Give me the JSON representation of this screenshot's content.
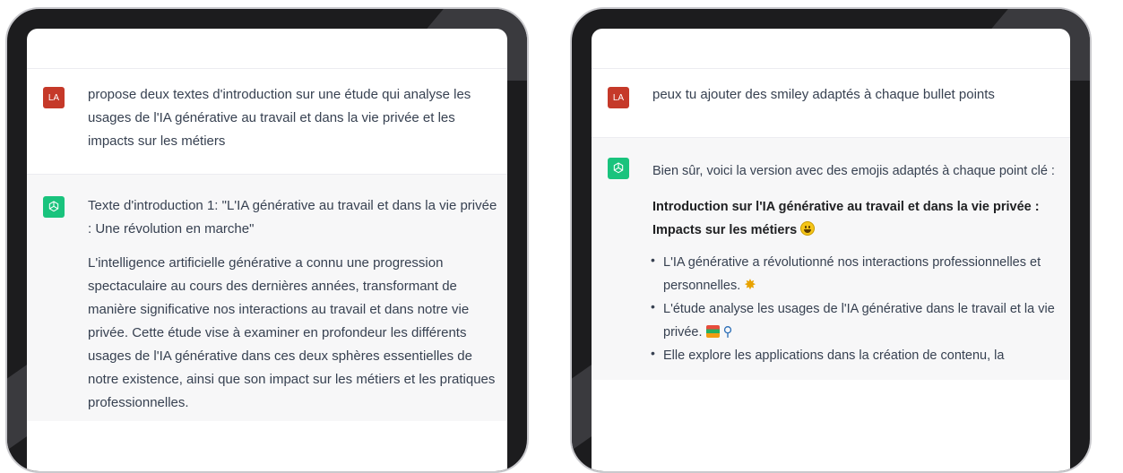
{
  "left": {
    "user": {
      "avatar_initials": "LA",
      "message": "propose deux textes d'introduction sur une étude qui analyse les usages de l'IA générative au travail et dans la vie privée et les impacts sur les métiers"
    },
    "assistant": {
      "heading": "Texte d'introduction 1: \"L'IA générative au travail et dans la vie privée : Une révolution en marche\"",
      "paragraph": "L'intelligence artificielle générative a connu une progression spectaculaire au cours des dernières années, transformant de manière significative nos interactions au travail et dans notre vie privée. Cette étude vise à examiner en profondeur les différents usages de l'IA générative dans ces deux sphères essentielles de notre existence, ainsi que son impact sur les métiers et les pratiques professionnelles."
    }
  },
  "right": {
    "user": {
      "avatar_initials": "LA",
      "message": "peux tu ajouter des smiley adaptés à chaque bullet points"
    },
    "assistant": {
      "intro": "Bien sûr, voici la version avec des emojis adaptés à chaque point clé :",
      "title": "Introduction sur l'IA générative au travail et dans la vie privée : Impacts sur les métiers",
      "bullets": [
        "L'IA générative a révolutionné nos interactions professionnelles et personnelles.",
        "L'étude analyse les usages de l'IA générative dans le travail et la vie privée.",
        "Elle explore les applications dans la création de contenu, la"
      ],
      "emoji_icons": [
        "grinning-face-icon",
        "sparkle-burst-icon",
        "books-icon",
        "magnifying-glass-icon"
      ]
    }
  },
  "colors": {
    "user_avatar": "#c53929",
    "assistant_avatar": "#19c37d",
    "assistant_row_bg": "#f7f7f8",
    "tablet_frame": "#1c1c1e"
  }
}
